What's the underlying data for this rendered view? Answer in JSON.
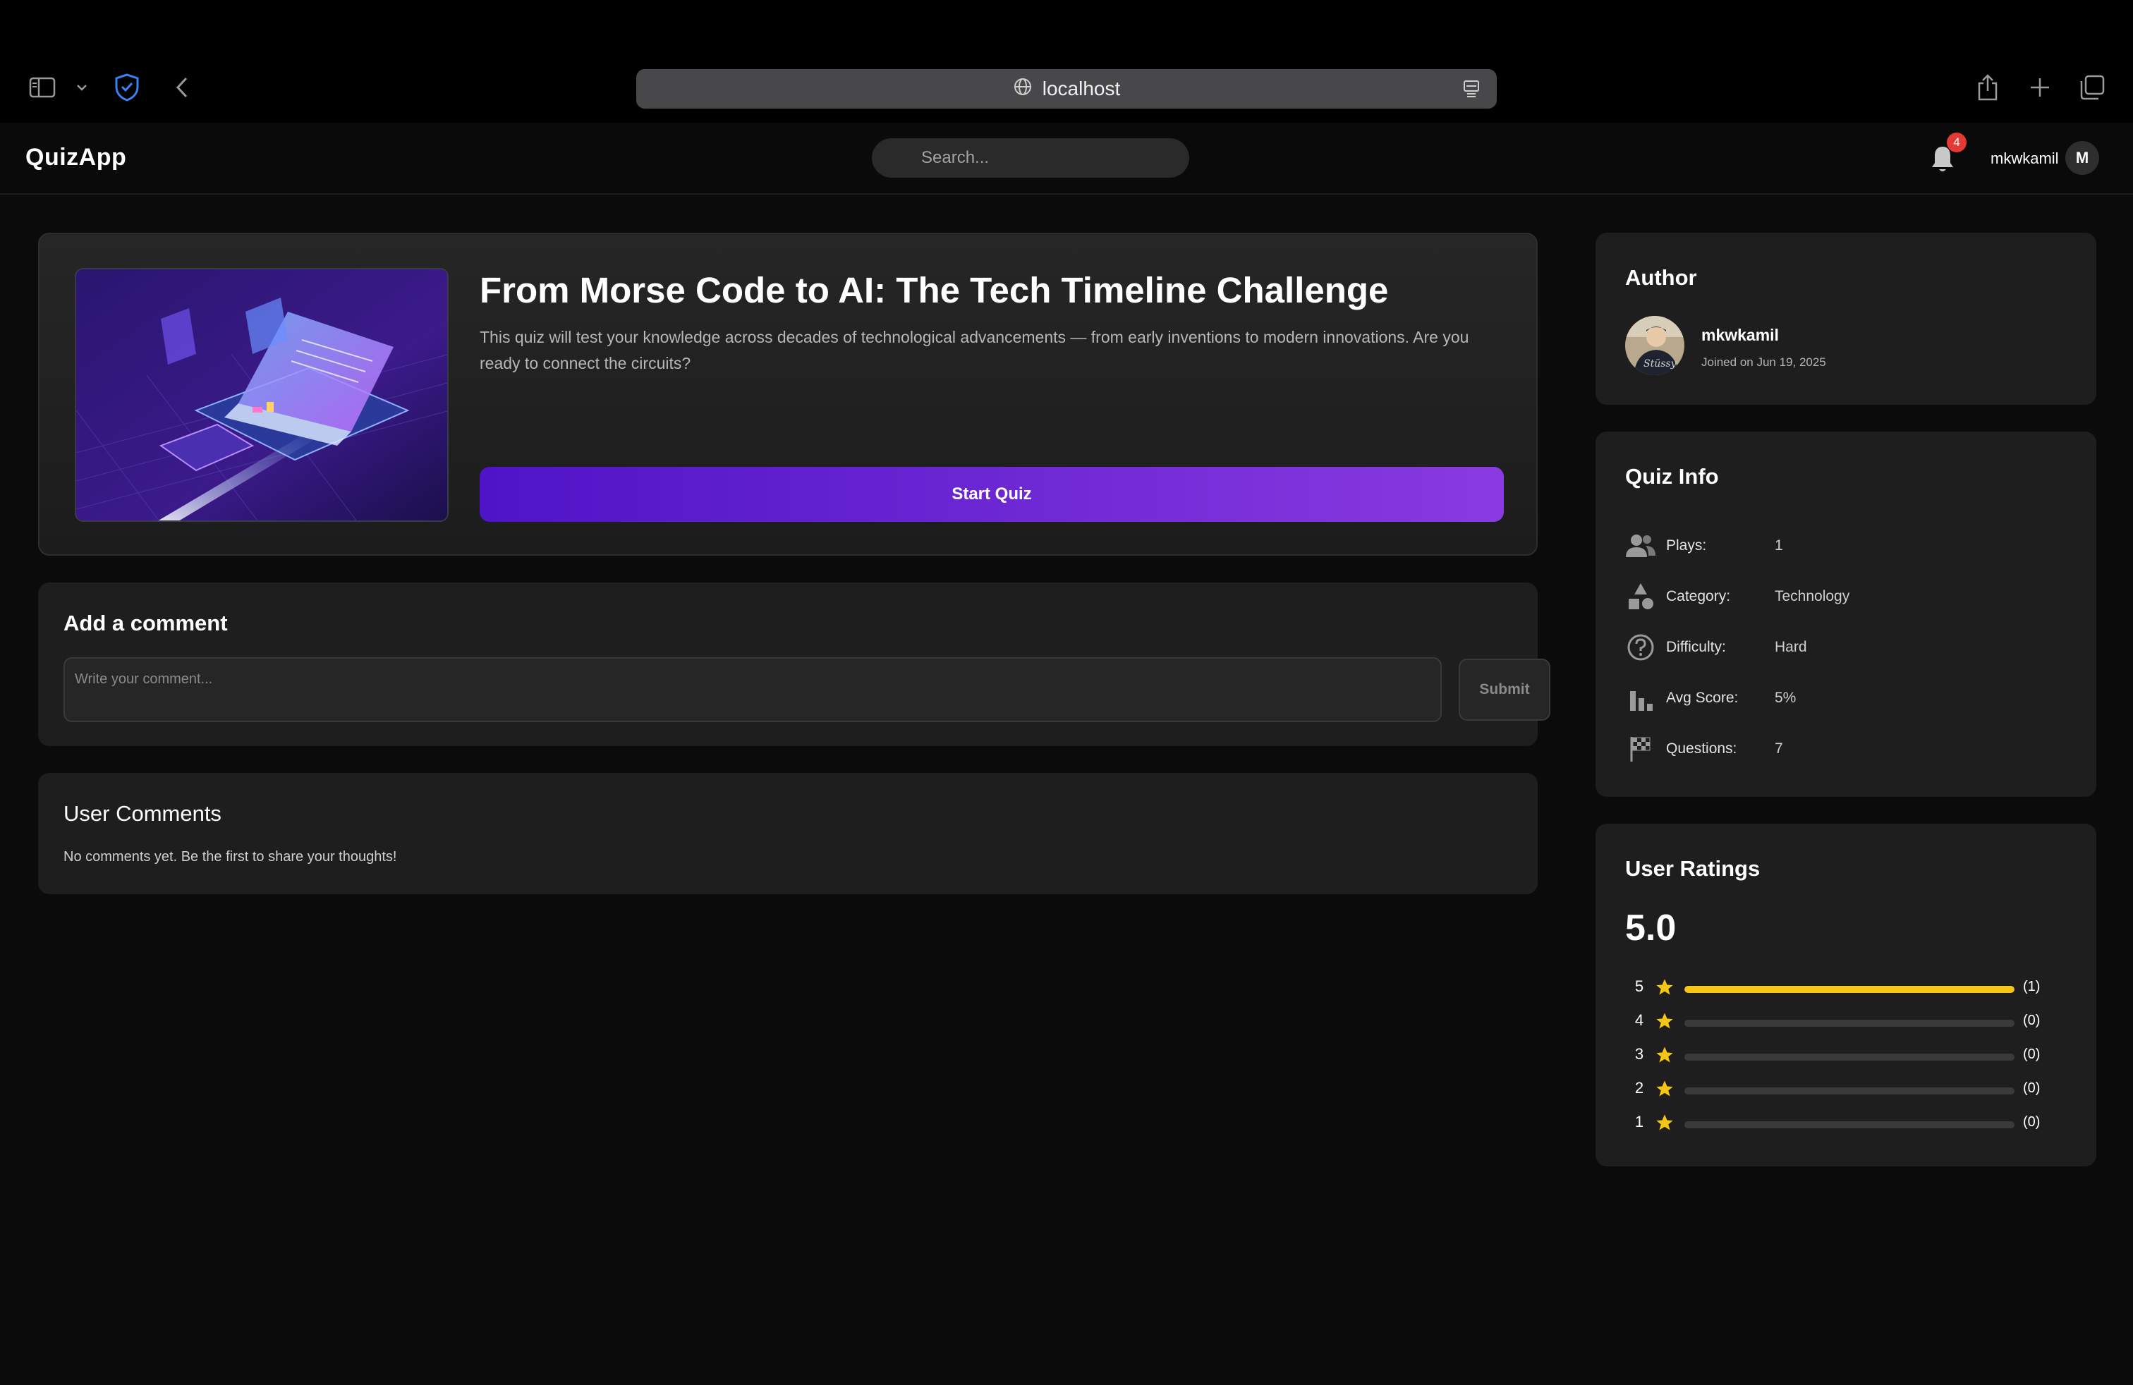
{
  "browser": {
    "url": "localhost"
  },
  "header": {
    "logo": "QuizApp",
    "search_placeholder": "Search...",
    "notification_count": "4",
    "username": "mkwkamil",
    "avatar_letter": "M"
  },
  "quiz": {
    "title": "From Morse Code to AI: The Tech Timeline Challenge",
    "description": "This quiz will test your knowledge across decades of technological advancements — from early inventions to modern innovations. Are you ready to connect the circuits?",
    "start_label": "Start Quiz"
  },
  "add_comment": {
    "heading": "Add a comment",
    "placeholder": "Write your comment...",
    "submit_label": "Submit"
  },
  "user_comments": {
    "heading": "User Comments",
    "empty_text": "No comments yet. Be the first to share your thoughts!"
  },
  "author": {
    "heading": "Author",
    "name": "mkwkamil",
    "joined": "Joined on Jun 19, 2025"
  },
  "quiz_info": {
    "heading": "Quiz Info",
    "rows": [
      {
        "icon": "people-icon",
        "label": "Plays:",
        "value": "1"
      },
      {
        "icon": "category-icon",
        "label": "Category:",
        "value": "Technology"
      },
      {
        "icon": "help-circle-icon",
        "label": "Difficulty:",
        "value": "Hard"
      },
      {
        "icon": "bar-chart-icon",
        "label": "Avg Score:",
        "value": "5%"
      },
      {
        "icon": "checkered-flag-icon",
        "label": "Questions:",
        "value": "7"
      }
    ]
  },
  "ratings": {
    "heading": "User Ratings",
    "score": "5.0",
    "star_color": "#f5c518",
    "rows": [
      {
        "stars": "5",
        "count": "(1)",
        "fraction": 1.0
      },
      {
        "stars": "4",
        "count": "(0)",
        "fraction": 0
      },
      {
        "stars": "3",
        "count": "(0)",
        "fraction": 0
      },
      {
        "stars": "2",
        "count": "(0)",
        "fraction": 0
      },
      {
        "stars": "1",
        "count": "(0)",
        "fraction": 0
      }
    ]
  },
  "colors": {
    "accent_start": "#4e14c7",
    "accent_end": "#8a3ae0",
    "badge": "#e53935"
  }
}
